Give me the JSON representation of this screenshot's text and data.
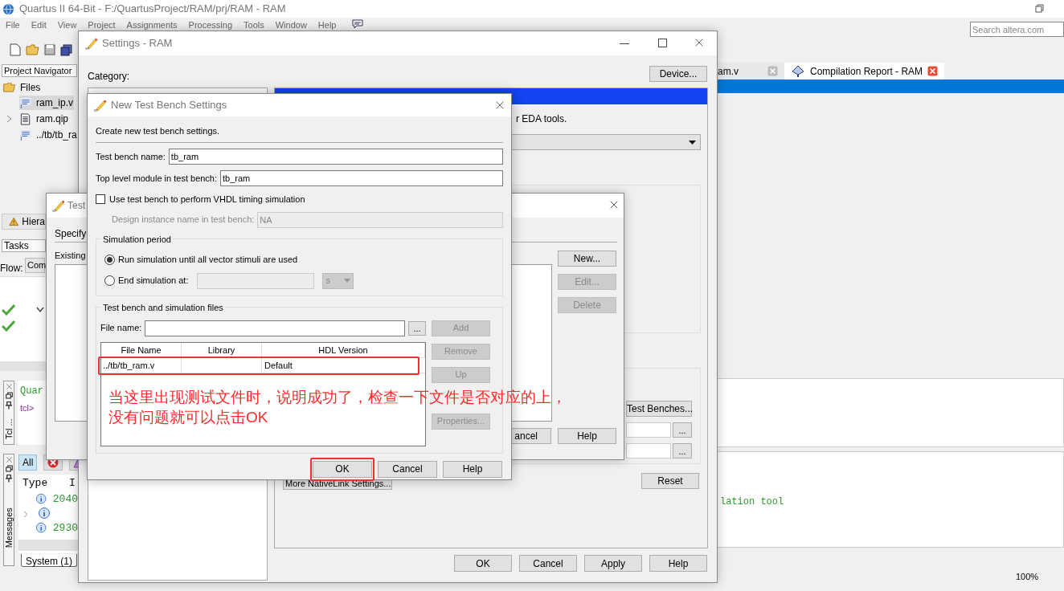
{
  "main_window": {
    "title": "Quartus II 64-Bit - F:/QuartusProject/RAM/prj/RAM - RAM",
    "menu": [
      "File",
      "Edit",
      "View",
      "Project",
      "Assignments",
      "Processing",
      "Tools",
      "Window",
      "Help"
    ],
    "search": {
      "placeholder": "Search altera.com"
    },
    "project_navigator": {
      "selector": "Project Navigator",
      "tree": [
        {
          "label": "Files",
          "kind": "folder",
          "expanded": true,
          "children": [
            {
              "label": "ram_ip.v",
              "kind": "verilog",
              "selected": true,
              "expandable": false
            },
            {
              "label": "ram.qip",
              "kind": "qip",
              "selected": false,
              "expandable": true
            },
            {
              "label": "../tb/tb_ra",
              "kind": "verilog",
              "selected": false,
              "expandable": false
            }
          ]
        }
      ]
    },
    "hierarchy_tab": "Hiera",
    "tasks_selector": "Tasks",
    "flow": {
      "label": "Flow:",
      "value": "Com"
    },
    "task_rows": [
      {
        "done": true,
        "expandable": true
      },
      {
        "done": true,
        "expandable": false
      }
    ],
    "tcl_console": {
      "title": "Tcl ...",
      "lines": [
        {
          "kind": "banner",
          "text": "Quar"
        },
        {
          "kind": "prompt",
          "text": "tcl>"
        }
      ]
    },
    "messages": {
      "title": "Messages",
      "filters": [
        {
          "kind": "all",
          "label": "All",
          "selected": true
        },
        {
          "kind": "error",
          "selected": false
        },
        {
          "kind": "warning",
          "selected": false
        }
      ],
      "columns": [
        "Type",
        "I"
      ],
      "rows": [
        {
          "kind": "info",
          "id": "2040",
          "expandable": false
        },
        {
          "kind": "info",
          "expandable": true
        },
        {
          "kind": "info",
          "id": "2930",
          "expandable": false
        }
      ],
      "tabs": [
        {
          "label": "System (1)",
          "selected": true
        }
      ]
    },
    "editor_tabs": [
      {
        "label": "am.v",
        "selected": false
      },
      {
        "label": "Compilation Report - RAM",
        "selected": true
      }
    ],
    "console_text": "lation tool",
    "zoom": "100%"
  },
  "settings_dialog": {
    "title": "Settings - RAM",
    "category_label": "Category:",
    "device_button": "Device...",
    "description": "r EDA tools.",
    "test_benches_button": "Test Benches...",
    "browse_buttons": [
      "...",
      "..."
    ],
    "more_button": "More NativeLink Settings...",
    "reset_button": "Reset",
    "buttons": [
      "OK",
      "Cancel",
      "Apply",
      "Help"
    ]
  },
  "test_benches_dialog": {
    "title": "Test",
    "intro": "Specify",
    "existing_label": "Existing",
    "side_buttons": [
      {
        "label": "New...",
        "disabled": false
      },
      {
        "label": "Edit...",
        "disabled": true
      },
      {
        "label": "Delete",
        "disabled": true
      }
    ],
    "footer_buttons": [
      "ancel",
      "Help"
    ]
  },
  "new_test_bench_dialog": {
    "title": "New Test Bench Settings",
    "intro": "Create new test bench settings.",
    "test_bench_name": {
      "label": "Test bench name:",
      "value": "tb_ram"
    },
    "top_module": {
      "label": "Top level module in test bench:",
      "value": "tb_ram"
    },
    "vhdl_timing": {
      "label": "Use test bench to perform VHDL timing simulation",
      "checked": false
    },
    "design_instance": {
      "label": "Design instance name in test bench:",
      "value": "NA",
      "disabled": true
    },
    "simulation_period": {
      "title": "Simulation period",
      "options": [
        {
          "label": "Run simulation until all vector stimuli are used",
          "selected": true
        },
        {
          "label": "End simulation at:",
          "selected": false
        }
      ],
      "unit": "s"
    },
    "files": {
      "title": "Test bench and simulation files",
      "file_name_label": "File name:",
      "browse": "...",
      "columns": [
        "File Name",
        "Library",
        "HDL Version"
      ],
      "rows": [
        {
          "file_name": "../tb/tb_ram.v",
          "hdl_version": "Default"
        }
      ],
      "side_buttons": [
        {
          "label": "Add",
          "disabled": true
        },
        {
          "label": "Remove",
          "disabled": true
        },
        {
          "label": "Up",
          "disabled": true
        },
        {
          "label": "Properties...",
          "disabled": true
        }
      ]
    },
    "buttons": [
      "OK",
      "Cancel",
      "Help"
    ]
  },
  "annotation": {
    "lines": [
      "当这里出现测试文件时，说明成功了，检查一下文件是否对应的上，",
      "没有问题就可以点击OK"
    ]
  }
}
